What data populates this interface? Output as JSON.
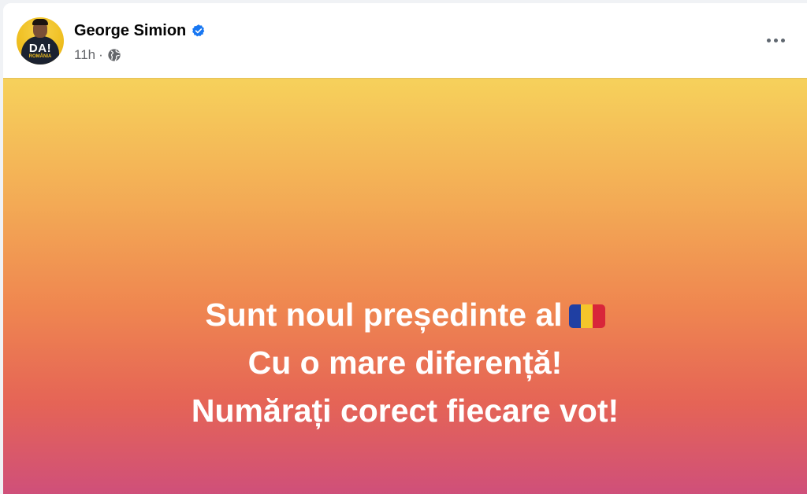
{
  "post": {
    "author": {
      "name": "George Simion",
      "verified": true,
      "avatar_icon": "portrait-avatar",
      "avatar_logo_text": "DA!",
      "avatar_logo_subtext": "ROMÂNIA"
    },
    "meta": {
      "time": "11h",
      "separator": "·",
      "audience_icon": "globe-icon"
    },
    "more_icon": "ellipsis-icon",
    "background": {
      "gradient_colors": [
        "#f6d15b",
        "#f3aa55",
        "#ef8650",
        "#e56456",
        "#cf4f7a"
      ]
    },
    "text_lines": [
      "Sunt noul președinte al",
      "Cu o mare diferență!",
      "Numărați corect fiecare vot!"
    ],
    "flag_icon": "romania-flag-icon",
    "flag_colors": [
      "#1f3fa3",
      "#f4c52b",
      "#d8263a"
    ]
  },
  "colors": {
    "verified_blue": "#1877f2",
    "meta_gray": "#65676b",
    "text_white": "#ffffff"
  }
}
